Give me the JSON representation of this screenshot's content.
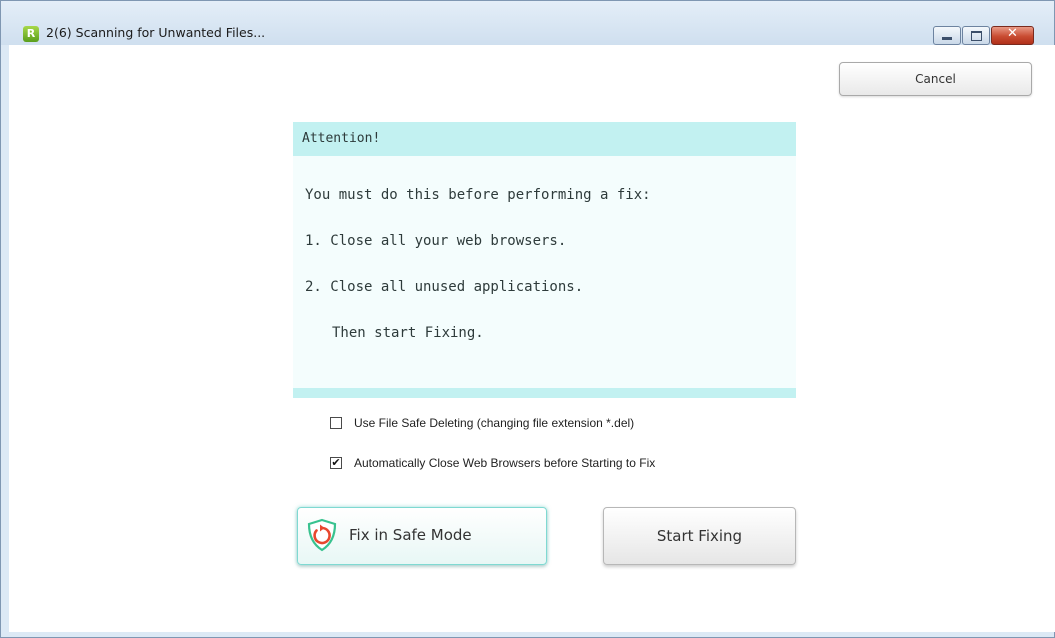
{
  "window": {
    "title": "2(6) Scanning for Unwanted Files...",
    "app_icon_letter": "R",
    "controls": {
      "minimize": "minimize",
      "maximize": "maximize",
      "close": "✕"
    }
  },
  "toolbar": {
    "cancel_label": "Cancel"
  },
  "attention": {
    "header": "Attention!",
    "intro": "You must do this before performing a fix:",
    "steps": [
      "1. Close all your web browsers.",
      "2. Close all unused applications."
    ],
    "outro": "Then start Fixing."
  },
  "options": [
    {
      "label": "Use File Safe Deleting (changing file extension *.del)",
      "checked": false
    },
    {
      "label": "Automatically Close Web Browsers before Starting to Fix",
      "checked": true,
      "mark": "✔"
    }
  ],
  "actions": {
    "safe_mode_label": "Fix in Safe Mode",
    "start_label": "Start Fixing"
  },
  "colors": {
    "panel_header": "#c2f1f1",
    "panel_body": "#f4fdfd",
    "shield_green": "#38c28f",
    "shield_red": "#e8472e"
  },
  "icons": {
    "app": "app-logo-icon",
    "safe_mode": "shield-refresh-icon"
  }
}
